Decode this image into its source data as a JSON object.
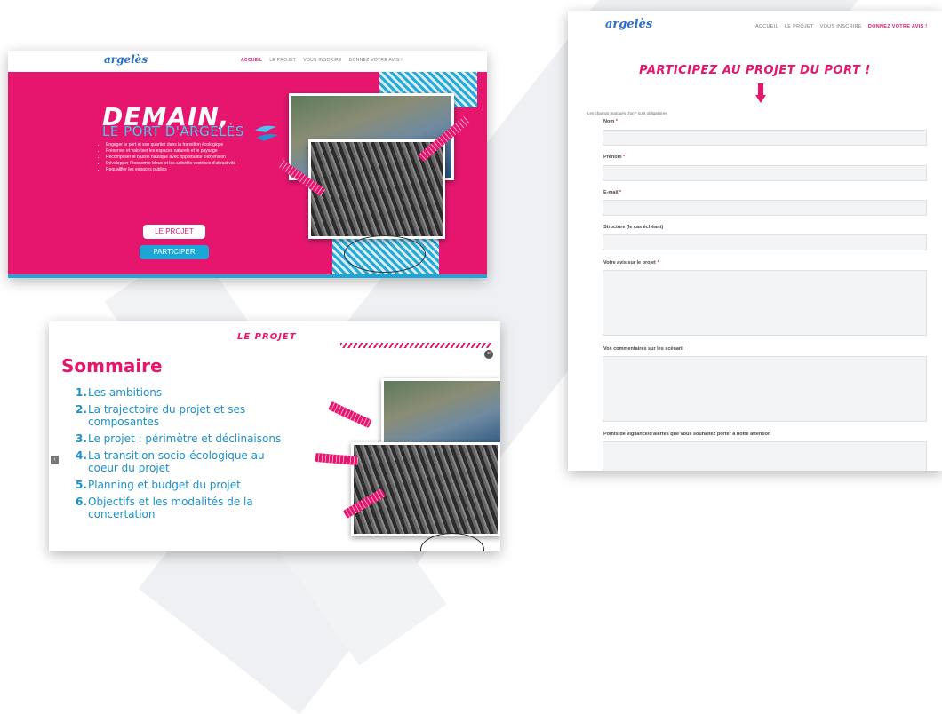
{
  "hero": {
    "logo_text": "argelès",
    "nav": [
      "ACCUEIL",
      "LE PROJET",
      "VOUS INSCRIRE",
      "DONNEZ VOTRE AVIS !"
    ],
    "title_line1": "DEMAIN,",
    "title_line2": "LE PORT D'ARGELÈS",
    "bullets": [
      "Engager le port et son quartier dans la transition écologique",
      "Préserver et valoriser les espaces naturels et le paysage",
      "Recomposer le bassin nautique avec opportunité d'extension",
      "Développer l'économie bleue et les activités vectrices d'attractivité",
      "Requalifier les espaces publics"
    ],
    "btn_projet": "LE PROJET",
    "btn_participer": "PARTICIPER",
    "colors": {
      "accent": "#e6166f",
      "blue": "#1ca6d5"
    }
  },
  "sommaire": {
    "header": "LE PROJET",
    "title": "Sommaire",
    "items": [
      {
        "num": "1.",
        "text": "Les ambitions"
      },
      {
        "num": "2.",
        "text": "La trajectoire du projet et ses composantes"
      },
      {
        "num": "3.",
        "text": "Le projet : périmètre et déclinaisons"
      },
      {
        "num": "4.",
        "text": "La transition socio-écologique au coeur du projet"
      },
      {
        "num": "5.",
        "text": "Planning et budget du projet"
      },
      {
        "num": "6.",
        "text": "Objectifs et les modalités de la concertation"
      }
    ],
    "prev_icon": "‹",
    "next_icon": "›",
    "close_icon": "×"
  },
  "form": {
    "logo_text": "argelès",
    "nav": [
      "ACCUEIL",
      "LE PROJET",
      "VOUS INSCRIRE",
      "DONNEZ VOTRE AVIS !"
    ],
    "title": "PARTICIPEZ AU PROJET DU PORT !",
    "required_note": "Les champs marqués d'un * sont obligatoires",
    "fields": {
      "nom": "Nom",
      "prenom": "Prénom",
      "email": "E-mail",
      "structure": "Structure (le cas échéant)",
      "avis": "Votre avis sur le projet",
      "commentaires": "Vos commentaires sur les scénarii",
      "vigilance": "Points de vigilance/d'alertes que vous souhaitez porter à notre attention"
    },
    "required_mark": "*"
  }
}
